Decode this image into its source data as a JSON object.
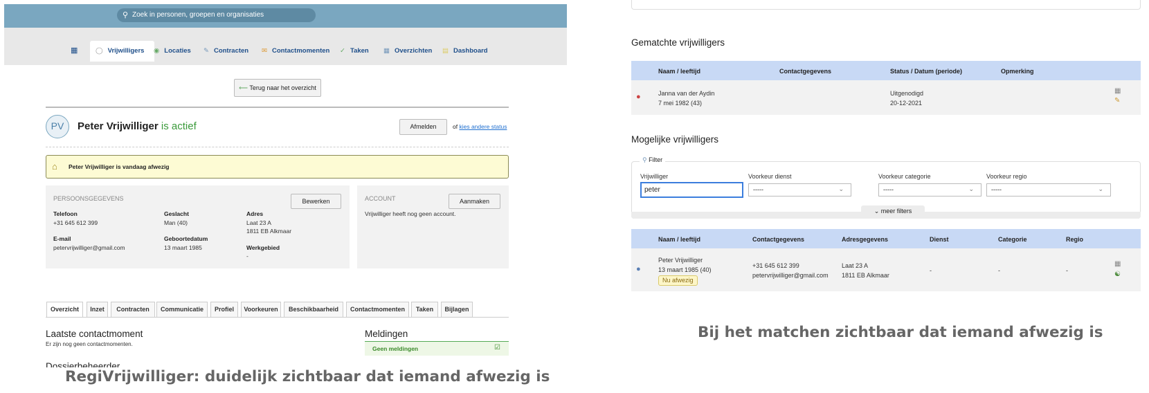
{
  "left": {
    "search_placeholder": "Zoek in personen, groepen en organisaties",
    "nav": [
      {
        "label": "Vrijwilligers",
        "icon": "person-icon"
      },
      {
        "label": "Locaties",
        "icon": "location-icon"
      },
      {
        "label": "Contracten",
        "icon": "contract-icon"
      },
      {
        "label": "Contactmomenten",
        "icon": "chat-icon"
      },
      {
        "label": "Taken",
        "icon": "check-icon"
      },
      {
        "label": "Overzichten",
        "icon": "calendar-icon"
      },
      {
        "label": "Dashboard",
        "icon": "chart-icon"
      }
    ],
    "back_button": "Terug naar het overzicht",
    "avatar": "PV",
    "person_name": "Peter Vrijwilliger",
    "status": "is actief",
    "afmelden": "Afmelden",
    "of": "of",
    "status_link": "kies andere status",
    "absent_notice": "Peter Vrijwilliger is vandaag afwezig",
    "persoonsgegevens": "PERSOONSGEGEVENS",
    "bewerken": "Bewerken",
    "telefoon_label": "Telefoon",
    "telefoon": "+31 645 612 399",
    "geslacht_label": "Geslacht",
    "geslacht": "Man (40)",
    "adres_label": "Adres",
    "adres1": "Laat 23 A",
    "adres2": "1811 EB Alkmaar",
    "email_label": "E-mail",
    "email": "petervrijwilliger@gmail.com",
    "geboorte_label": "Geboortedatum",
    "geboorte": "13 maart 1985",
    "werkgebied_label": "Werkgebied",
    "werkgebied": "-",
    "account": "ACCOUNT",
    "aanmaken": "Aanmaken",
    "account_text": "Vrijwilliger heeft nog geen account.",
    "tabs": [
      "Overzicht",
      "Inzet",
      "Contracten",
      "Communicatie",
      "Profiel",
      "Voorkeuren",
      "Beschikbaarheid",
      "Contactmomenten",
      "Taken",
      "Bijlagen"
    ],
    "laatste": "Laatste contactmoment",
    "geen_contact": "Er zijn nog geen contactmomenten.",
    "dossier": "Dossierbeheerder",
    "meldingen": "Meldingen",
    "geen_meldingen": "Geen meldingen"
  },
  "right": {
    "gematchte": "Gematchte vrijwilligers",
    "th1": [
      "Naam / leeftijd",
      "Contactgegevens",
      "Status / Datum (periode)",
      "Opmerking"
    ],
    "janna_name": "Janna van der Aydin",
    "janna_date": "7 mei 1982 (43)",
    "janna_status": "Uitgenodigd",
    "janna_datum": "20-12-2021",
    "mogelijke": "Mogelijke vrijwilligers",
    "filter": "Filter",
    "f_vrijwilliger": "Vrijwilliger",
    "f_vrijwilliger_val": "peter",
    "f_dienst": "Voorkeur dienst",
    "f_dienst_val": "-----",
    "f_categorie": "Voorkeur categorie",
    "f_categorie_val": "-----",
    "f_regio": "Voorkeur regio",
    "f_regio_val": "-----",
    "meer_filters": "meer filters",
    "th2": [
      "Naam / leeftijd",
      "Contactgegevens",
      "Adresgegevens",
      "Dienst",
      "Categorie",
      "Regio"
    ],
    "peter_name": "Peter Vrijwilliger",
    "peter_date": "13 maart 1985 (40)",
    "peter_badge": "Nu afwezig",
    "peter_tel": "+31 645 612 399",
    "peter_email": "petervrijwilliger@gmail.com",
    "peter_adres1": "Laat 23 A",
    "peter_adres2": "1811 EB Alkmaar",
    "peter_dienst": "-",
    "peter_cat": "-",
    "peter_regio": "-"
  },
  "captions": {
    "left": "RegiVrijwilliger: duidelijk zichtbaar dat iemand afwezig is",
    "right": "Bij het matchen zichtbaar dat iemand afwezig is"
  },
  "colors": {
    "nav_blue": "#7aa7c0",
    "link": "#1f4f8a",
    "active_green": "#3a9a3a",
    "notice_bg": "#fdfbd4",
    "table_header": "#c8d9f5",
    "badge": "#fdf6c8"
  }
}
